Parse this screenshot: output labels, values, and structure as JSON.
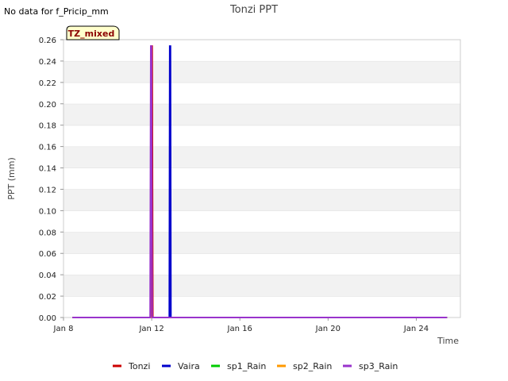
{
  "note": "No data for f_Pricip_mm",
  "badge": {
    "label": "TZ_mixed",
    "bg": "#ffffcc",
    "fg": "#8b0000"
  },
  "chart_data": {
    "type": "line",
    "title": "Tonzi PPT",
    "xlabel": "Time",
    "ylabel": "PPT (mm)",
    "x_ticks": [
      {
        "day": 8,
        "label": "Jan 8"
      },
      {
        "day": 12,
        "label": "Jan 12"
      },
      {
        "day": 16,
        "label": "Jan 16"
      },
      {
        "day": 20,
        "label": "Jan 20"
      },
      {
        "day": 24,
        "label": "Jan 24"
      }
    ],
    "y_ticks": [
      "0.00",
      "0.02",
      "0.04",
      "0.06",
      "0.08",
      "0.10",
      "0.12",
      "0.14",
      "0.16",
      "0.18",
      "0.20",
      "0.22",
      "0.24",
      "0.26"
    ],
    "xlim": [
      8,
      26
    ],
    "ylim": [
      0,
      0.26
    ],
    "grid": "horizontal bands",
    "legend_position": "bottom",
    "series": [
      {
        "name": "Tonzi",
        "color": "#cc0000",
        "points": [
          [
            8.4,
            0
          ],
          [
            11.95,
            0
          ],
          [
            11.98,
            0.254
          ],
          [
            12.02,
            0.254
          ],
          [
            12.05,
            0
          ],
          [
            25.4,
            0
          ]
        ]
      },
      {
        "name": "Vaira",
        "color": "#0000cc",
        "points": [
          [
            8.4,
            0
          ],
          [
            12.8,
            0
          ],
          [
            12.82,
            0.254
          ],
          [
            12.85,
            0.254
          ],
          [
            12.87,
            0
          ],
          [
            25.4,
            0
          ]
        ]
      },
      {
        "name": "sp1_Rain",
        "color": "#00cc00",
        "points": [
          [
            8.4,
            0
          ],
          [
            25.4,
            0
          ]
        ]
      },
      {
        "name": "sp2_Rain",
        "color": "#ff9900",
        "points": [
          [
            8.4,
            0
          ],
          [
            25.4,
            0
          ]
        ]
      },
      {
        "name": "sp3_Rain",
        "color": "#9933cc",
        "points": [
          [
            8.4,
            0
          ],
          [
            11.93,
            0
          ],
          [
            11.96,
            0.254
          ],
          [
            11.99,
            0.254
          ],
          [
            12.02,
            0
          ],
          [
            25.4,
            0
          ]
        ]
      }
    ]
  }
}
